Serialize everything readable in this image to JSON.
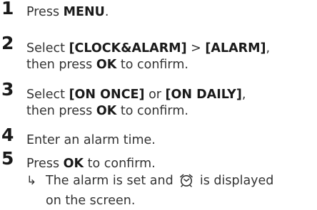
{
  "steps": [
    {
      "num": "1",
      "parts": [
        "Press ",
        "MENU",
        "."
      ]
    },
    {
      "num": "2",
      "line1": [
        "Select ",
        "[CLOCK&ALARM]",
        " > ",
        "[ALARM]",
        ","
      ],
      "line2": [
        "then press ",
        "OK",
        " to confirm."
      ]
    },
    {
      "num": "3",
      "line1": [
        "Select ",
        "[ON ONCE]",
        " or ",
        "[ON DAILY]",
        ","
      ],
      "line2": [
        "then press ",
        "OK",
        " to confirm."
      ]
    },
    {
      "num": "4",
      "text": "Enter an alarm time."
    },
    {
      "num": "5",
      "parts": [
        "Press ",
        "OK",
        " to confirm."
      ]
    }
  ],
  "result": {
    "arrow": "↳",
    "line1_before": "The alarm is set and",
    "line1_after": "is displayed",
    "line2": "on the screen.",
    "icon": "alarm-clock-icon"
  }
}
